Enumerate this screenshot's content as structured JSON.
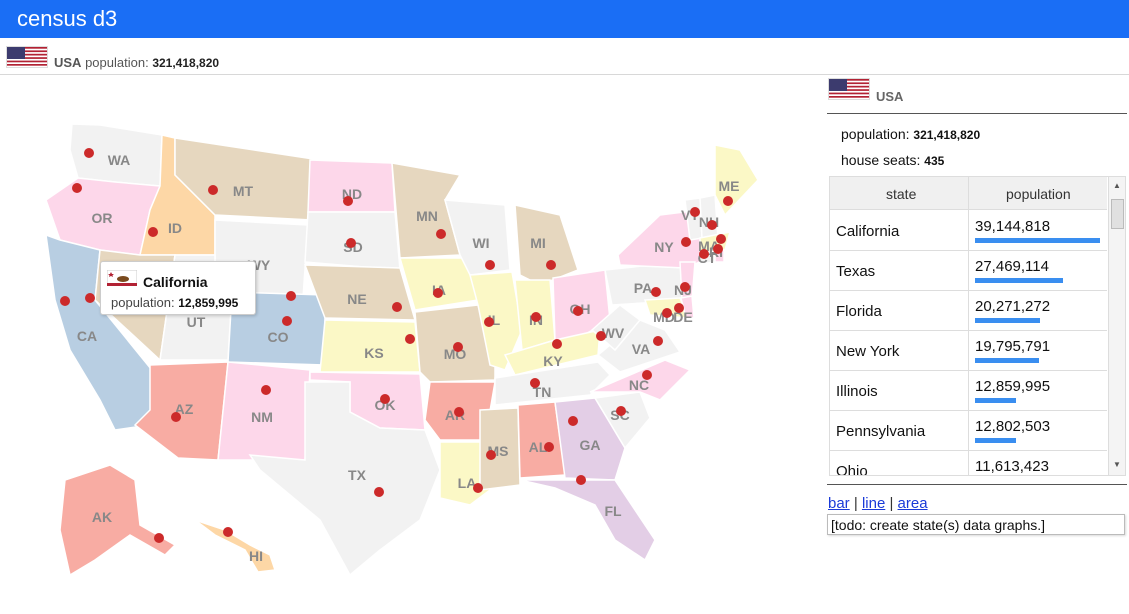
{
  "app": {
    "title": "census d3"
  },
  "country": {
    "code": "USA",
    "population_label": "population:",
    "population": "321,418,820",
    "house_seats_label": "house seats:",
    "house_seats": "435"
  },
  "tooltip": {
    "state": "California",
    "population_label": "population:",
    "population": "12,859,995"
  },
  "table": {
    "headers": [
      "state",
      "population"
    ],
    "rows": [
      {
        "state": "California",
        "population": "39,144,818",
        "share": 1.0
      },
      {
        "state": "Texas",
        "population": "27,469,114",
        "share": 0.7
      },
      {
        "state": "Florida",
        "population": "20,271,272",
        "share": 0.52
      },
      {
        "state": "New York",
        "population": "19,795,791",
        "share": 0.51
      },
      {
        "state": "Illinois",
        "population": "12,859,995",
        "share": 0.33
      },
      {
        "state": "Pennsylvania",
        "population": "12,802,503",
        "share": 0.33
      },
      {
        "state": "Ohio",
        "population": "11,613,423",
        "share": 0.3
      }
    ]
  },
  "links": {
    "bar": "bar",
    "line": "line",
    "area": "area",
    "sep": "|"
  },
  "todo": "[todo: create state(s) data graphs.]",
  "map_labels": [
    "WA",
    "OR",
    "CA",
    "ID",
    "MT",
    "WY",
    "NV",
    "UT",
    "CO",
    "AZ",
    "NM",
    "ND",
    "SD",
    "NE",
    "KS",
    "OK",
    "TX",
    "MN",
    "IA",
    "MO",
    "AR",
    "LA",
    "WI",
    "IL",
    "MI",
    "IN",
    "OH",
    "KY",
    "TN",
    "MS",
    "AL",
    "GA",
    "FL",
    "SC",
    "NC",
    "VA",
    "WV",
    "PA",
    "NY",
    "VT",
    "NH",
    "ME",
    "MA",
    "CT",
    "RI",
    "NJ",
    "DE",
    "MD",
    "AK",
    "HI"
  ],
  "colors": {
    "accent": "#1a6ef5",
    "dot": "#cc2a2a",
    "bar": "#3a8ef0"
  }
}
